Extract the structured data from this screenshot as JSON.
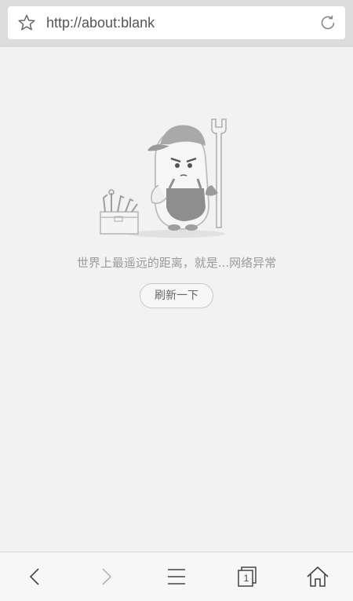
{
  "address_bar": {
    "url": "http://about:blank",
    "star_icon": "star-icon",
    "refresh_icon": "refresh-icon"
  },
  "error_page": {
    "illustration": "mechanic-mascot-with-wrench-and-toolbox",
    "message": "世界上最遥远的距离，就是...网络异常",
    "reload_button": "刷新一下"
  },
  "toolbar": {
    "back_icon": "chevron-left-icon",
    "forward_icon": "chevron-right-icon",
    "menu_icon": "menu-icon",
    "tabs_icon": "tabs-icon",
    "tab_count": "1",
    "home_icon": "home-icon"
  },
  "colors": {
    "background": "#f2f2f2",
    "topbar": "#dcdcdc",
    "text_muted": "#9a9a9a",
    "icon_gray": "#555555"
  }
}
